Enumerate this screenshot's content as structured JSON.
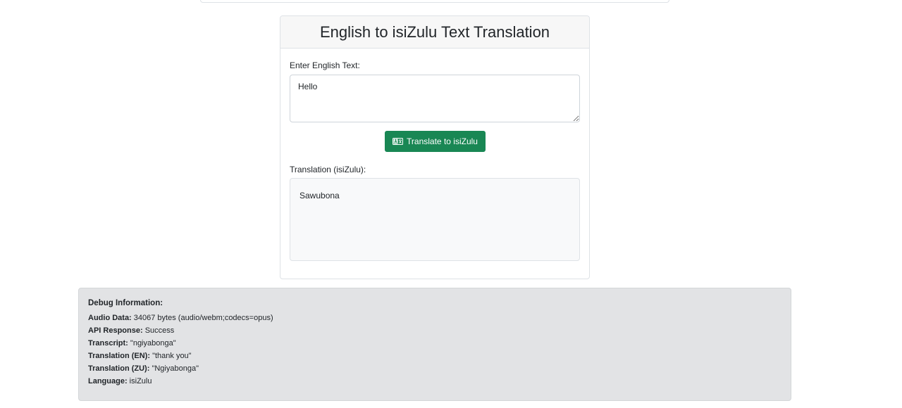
{
  "card": {
    "title": "English to isiZulu Text Translation",
    "input_label": "Enter English Text:",
    "input_value": "Hello",
    "button_label": "Translate to isiZulu",
    "output_label": "Translation (isiZulu):",
    "output_value": "Sawubona"
  },
  "debug": {
    "heading": "Debug Information:",
    "rows": [
      {
        "key": "Audio Data:",
        "value": " 34067 bytes (audio/webm;codecs=opus)"
      },
      {
        "key": "API Response:",
        "value": " Success"
      },
      {
        "key": "Transcript:",
        "value": " \"ngiyabonga\""
      },
      {
        "key": "Translation (EN):",
        "value": " \"thank you\""
      },
      {
        "key": "Translation (ZU):",
        "value": " \"Ngiyabonga\""
      },
      {
        "key": "Language:",
        "value": " isiZulu"
      }
    ]
  },
  "colors": {
    "accent": "#198754",
    "debug_bg": "#e2e3e5",
    "header_bg": "#f7f7f7"
  },
  "icons": {
    "translate_button_icon": "translate-icon"
  }
}
